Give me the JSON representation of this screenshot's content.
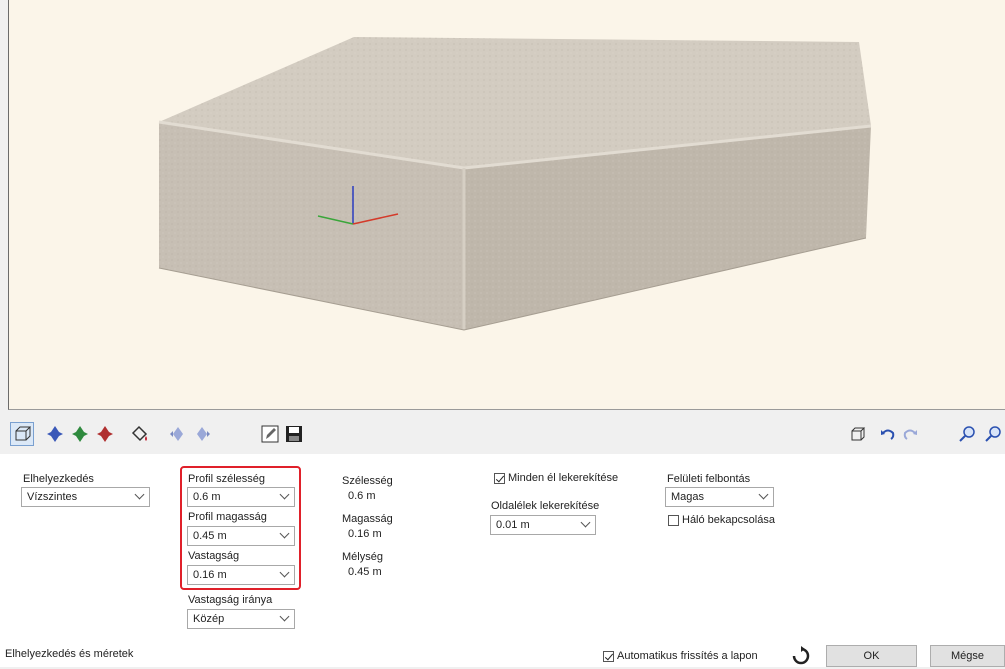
{
  "viewport": {
    "background": "#fbf5e9"
  },
  "toolbar": {
    "buttons": [
      "view-3d-icon",
      "rotate-blue-icon",
      "rotate-green-icon",
      "rotate-red-icon",
      "paint-bucket-icon",
      "move-left-icon",
      "move-right-icon",
      "edit-icon",
      "save-icon",
      "box-view-icon",
      "undo-icon",
      "redo-icon",
      "zoom-in-icon",
      "zoom-out-icon"
    ]
  },
  "placement": {
    "label": "Elhelyezkedés",
    "value": "Vízszintes"
  },
  "profile": {
    "width_label": "Profil szélesség",
    "width_value": "0.6 m",
    "height_label": "Profil magasság",
    "height_value": "0.45 m",
    "thickness_label": "Vastagság",
    "thickness_value": "0.16 m",
    "direction_label": "Vastagság iránya",
    "direction_value": "Közép"
  },
  "dimensions": {
    "width_label": "Szélesség",
    "width_value": "0.6 m",
    "height_label": "Magasság",
    "height_value": "0.16 m",
    "depth_label": "Mélység",
    "depth_value": "0.45 m"
  },
  "rounding": {
    "all_edges_label": "Minden él lekerekítése",
    "all_edges_checked": true,
    "side_edges_label": "Oldalélek lekerekítése",
    "side_edges_value": "0.01 m"
  },
  "surface": {
    "resolution_label": "Felületi felbontás",
    "resolution_value": "Magas",
    "mesh_label": "Háló bekapcsolása",
    "mesh_checked": false
  },
  "footer": {
    "section_label": "Elhelyezkedés és méretek",
    "auto_refresh_label": "Automatikus frissítés a lapon",
    "auto_refresh_checked": true,
    "ok_label": "OK",
    "cancel_label": "Mégse"
  },
  "colors": {
    "highlight": "#e0202a",
    "stone_top": "#cfc8bd",
    "stone_side": "#bdb5a9",
    "stone_front": "#c6beb3"
  }
}
